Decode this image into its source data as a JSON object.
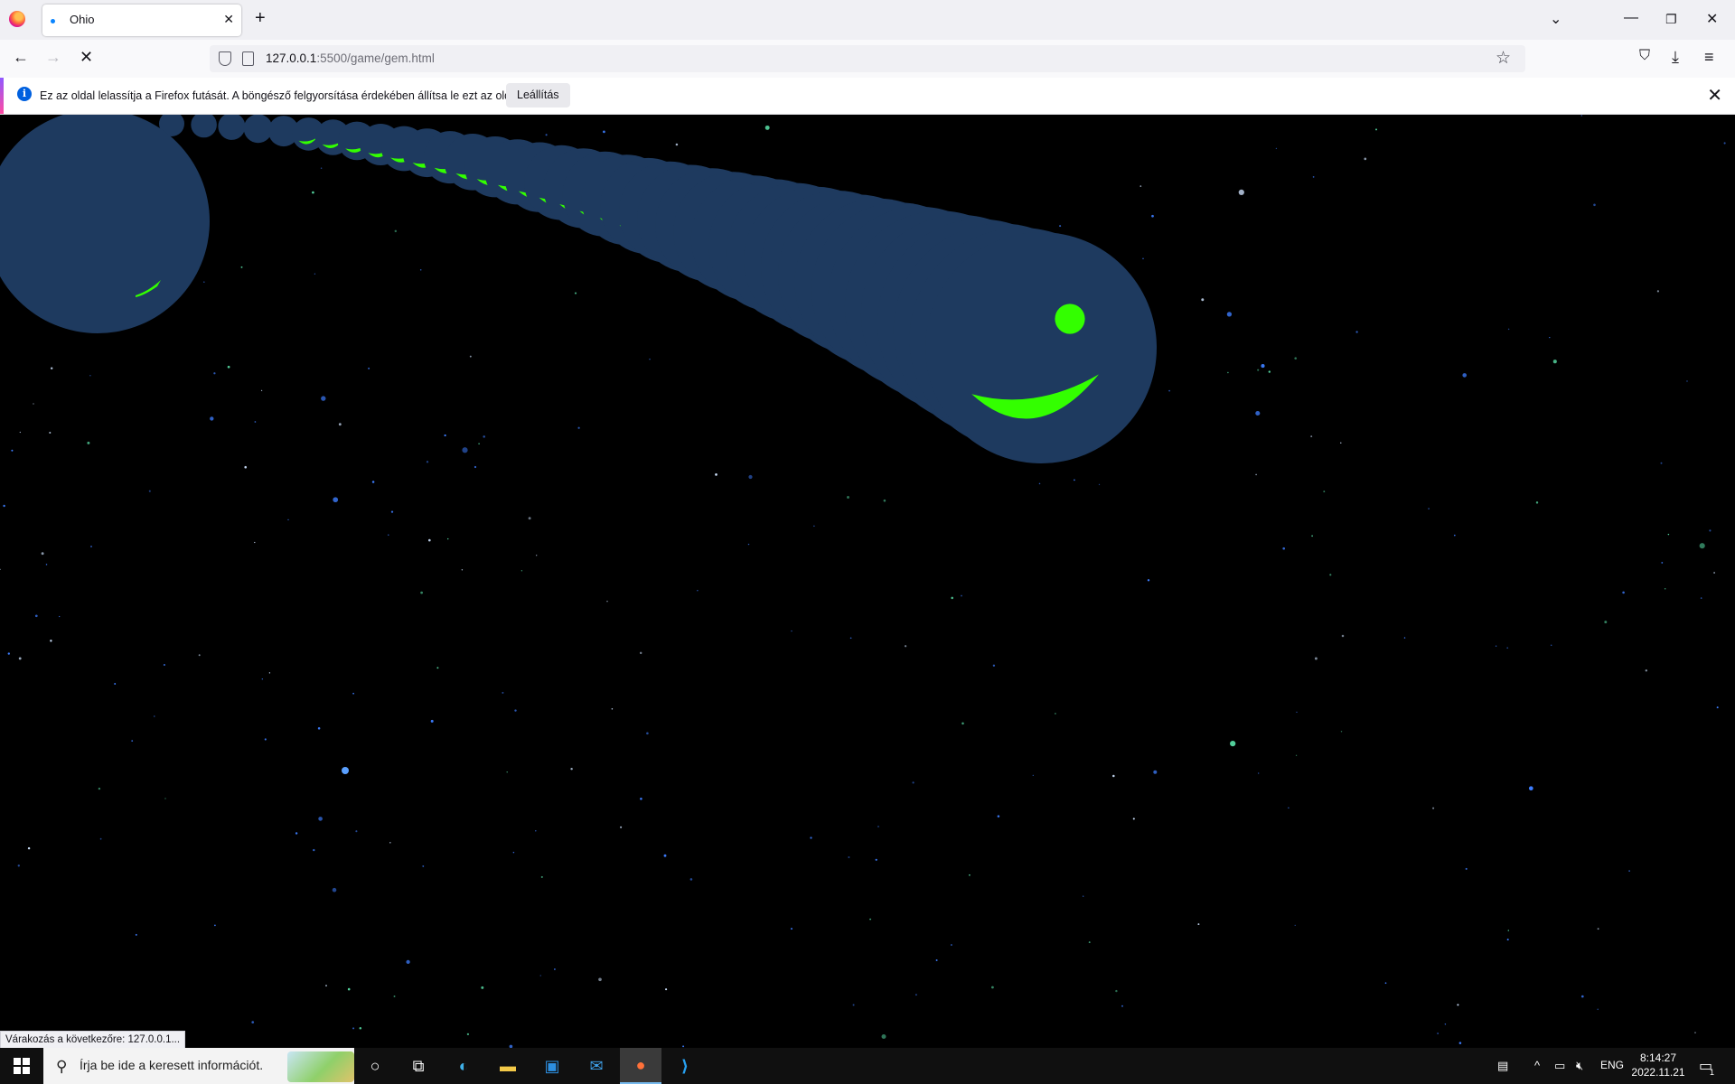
{
  "browser": {
    "tab": {
      "title": "Ohio"
    },
    "url": {
      "host": "127.0.0.1",
      "path": ":5500/game/gem.html"
    },
    "notification": {
      "message": "Ez az oldal lelassítja a Firefox futását. A böngésző felgyorsítása érdekében állítsa le ezt az oldalt.",
      "stop_label": "Leállítás"
    },
    "status": "Várakozás a következőre: 127.0.0.1..."
  },
  "taskbar": {
    "search_placeholder": "Írja be ide a keresett információt.",
    "language": "ENG",
    "time": "8:14:27",
    "date": "2022.11.21",
    "notifications_count": "1"
  },
  "colors": {
    "snake_body": "#1e3a5f",
    "snake_face": "#33ff00",
    "background": "#000000"
  },
  "icons": [
    "firefox-icon",
    "back-icon",
    "forward-icon",
    "stop-load-icon",
    "shield-icon",
    "page-icon",
    "star-icon",
    "pocket-icon",
    "download-icon",
    "menu-icon",
    "info-icon",
    "close-icon",
    "windows-start-icon",
    "search-icon",
    "cortana-icon",
    "task-view-icon",
    "edge-icon",
    "file-explorer-icon",
    "store-icon",
    "mail-icon",
    "vscode-icon",
    "news-icon",
    "chevron-up-icon",
    "network-icon",
    "volume-muted-icon",
    "notification-icon"
  ]
}
